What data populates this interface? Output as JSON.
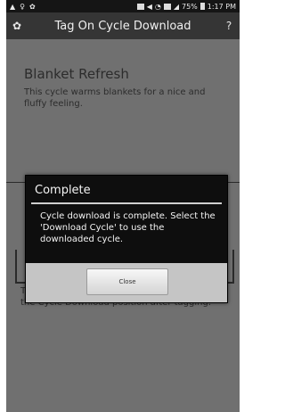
{
  "status_bar": {
    "time": "1:17 PM",
    "battery": "75%",
    "left_icons": [
      "warning-icon",
      "location-icon",
      "settings-icon"
    ],
    "right_icons": [
      "screen-icon",
      "volume-icon",
      "wifi-icon",
      "sim-icon",
      "signal-icon",
      "battery-icon"
    ]
  },
  "app_bar": {
    "title": "Tag On Cycle Download",
    "home_icon": "home-icon",
    "help_icon": "help-icon",
    "help_glyph": "?"
  },
  "cycle": {
    "name": "Blanket Refresh",
    "description": "This cycle warms blankets for a nice and fluffy feeling."
  },
  "footer": {
    "text": "The cycle will be downloaded and saved in the Cycle Download position after tagging."
  },
  "dialog": {
    "title": "Complete",
    "message": "Cycle download is complete. Select the 'Download Cycle' to use the downloaded cycle.",
    "close_label": "Close"
  }
}
